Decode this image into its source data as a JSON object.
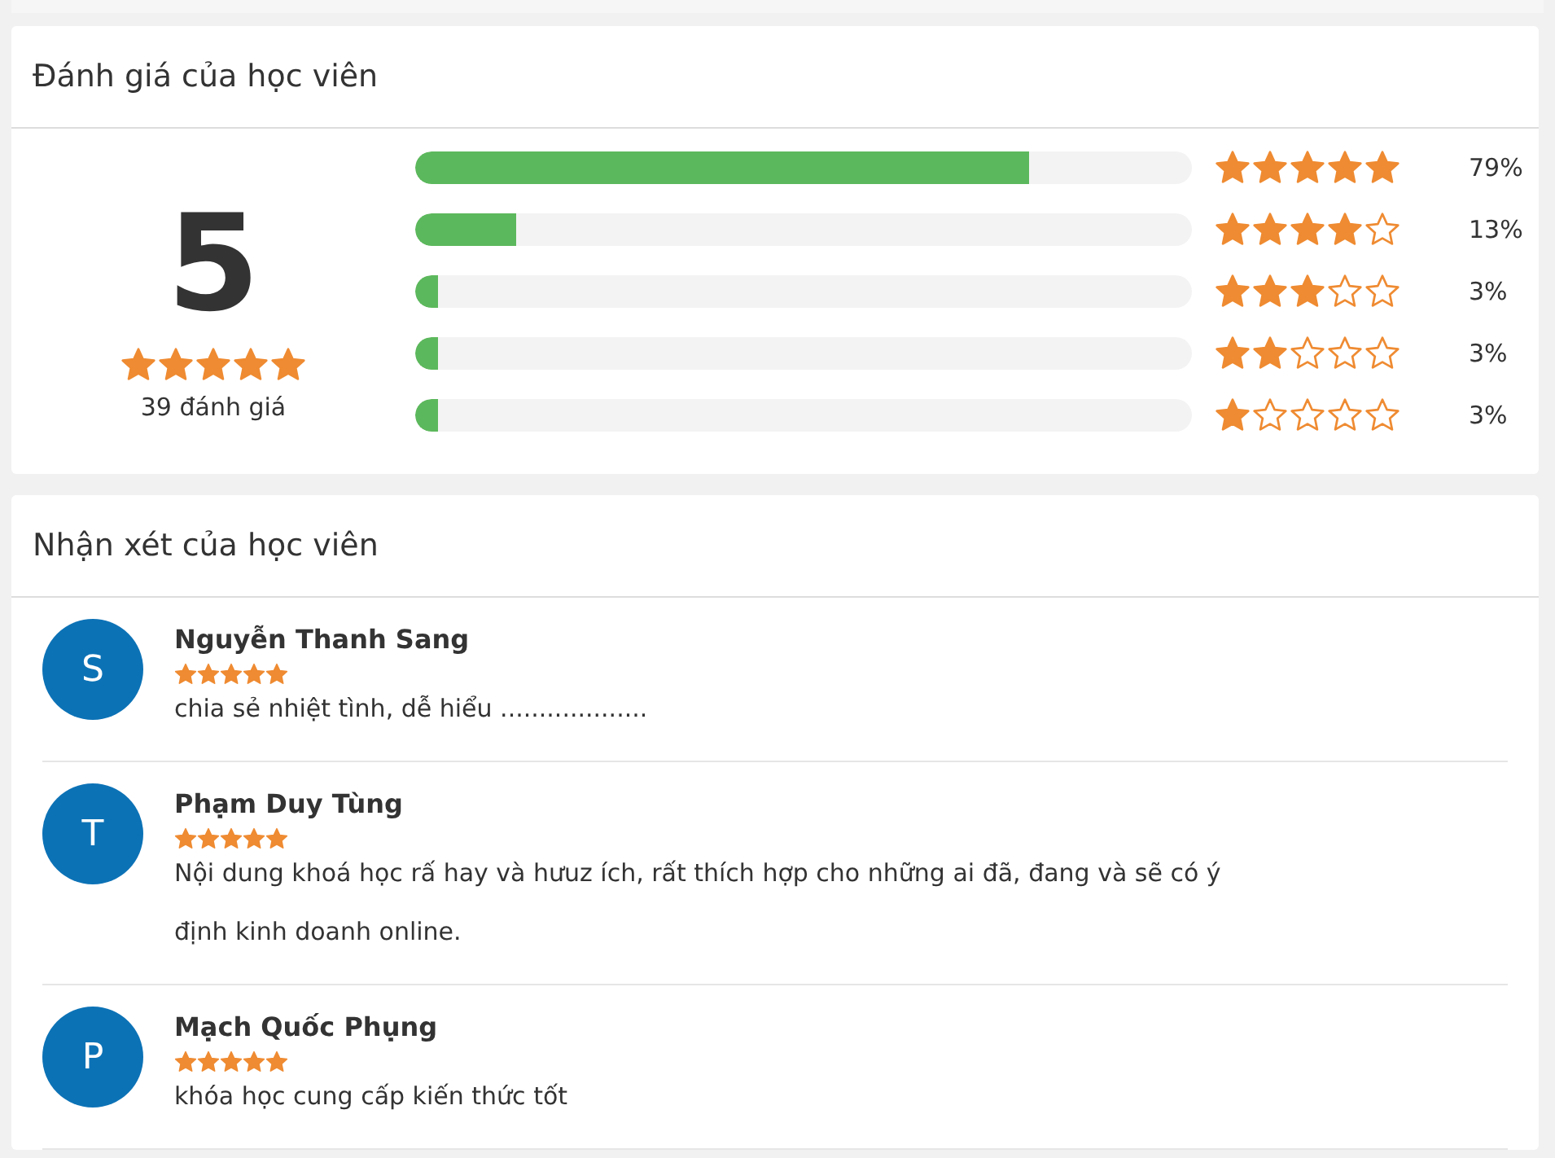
{
  "rating_card": {
    "title": "Đánh giá của học viên",
    "average": "5",
    "stars": 5,
    "count": "39 đánh giá",
    "breakdown": [
      {
        "level": 0.79,
        "stars": 5,
        "percent": "79%"
      },
      {
        "level": 0.13,
        "stars": 4,
        "percent": "13%"
      },
      {
        "level": 0.03,
        "stars": 3,
        "percent": "3%"
      },
      {
        "level": 0.03,
        "stars": 2,
        "percent": "3%"
      },
      {
        "level": 0.03,
        "stars": 1,
        "percent": "3%"
      }
    ]
  },
  "reviews_card": {
    "title": "Nhận xét của học viên",
    "reviews": [
      {
        "initial": "S",
        "name": "Nguyễn Thanh Sang",
        "stars": 5,
        "text": "chia sẻ nhiệt tình, dễ hiểu ..................."
      },
      {
        "initial": "T",
        "name": "Phạm Duy Tùng",
        "stars": 5,
        "text": "Nội dung khoá học rấ hay và hưuz ích, rất thích hợp cho những ai đã, đang và sẽ có ý định kinh doanh online."
      },
      {
        "initial": "P",
        "name": "Mạch Quốc Phụng",
        "stars": 5,
        "text": "khóa học cung cấp kiến thức tốt"
      }
    ]
  }
}
